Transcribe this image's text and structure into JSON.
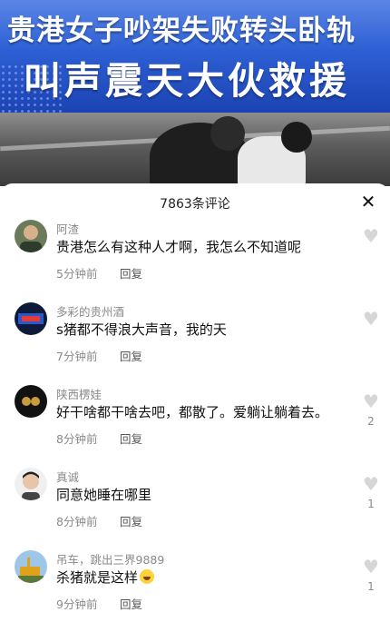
{
  "video": {
    "title_line1": "贵港女子吵架失败转头卧轨",
    "title_line2": "叫声震天大伙救援"
  },
  "comments_panel": {
    "title": "7863条评论",
    "close_icon": "close-icon",
    "comments": [
      {
        "user": "阿渣",
        "text": "贵港怎么有这种人才啊，我怎么不知道呢",
        "time": "5分钟前",
        "reply_label": "回复",
        "likes": ""
      },
      {
        "user": "多彩的贵州酒",
        "text": "s猪都不得浪大声音，我的天",
        "time": "7分钟前",
        "reply_label": "回复",
        "likes": ""
      },
      {
        "user": "陕西楞娃",
        "text": "好干啥都干啥去吧，都散了。爱躺让躺着去。",
        "time": "8分钟前",
        "reply_label": "回复",
        "likes": "2"
      },
      {
        "user": "真诚",
        "text": "同意她睡在哪里",
        "time": "8分钟前",
        "reply_label": "回复",
        "likes": "1"
      },
      {
        "user": "吊车，跳出三界9889",
        "text": "杀猪就是这样",
        "time": "9分钟前",
        "reply_label": "回复",
        "likes": "1"
      }
    ]
  },
  "colors": {
    "banner_blue": "#2d5fd4",
    "muted_text": "#8a8a8a",
    "heart": "#d6d6d6"
  }
}
